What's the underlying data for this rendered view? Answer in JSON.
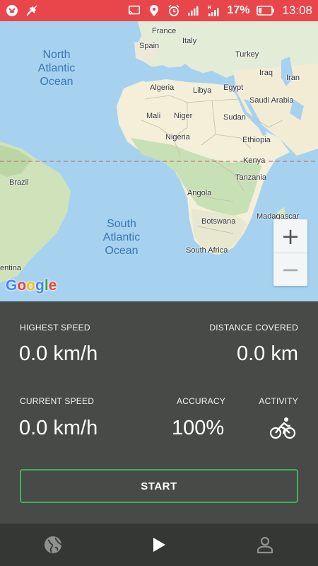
{
  "status_bar": {
    "battery_percent": "17%",
    "time": "13:08",
    "background_color": "#e8464a",
    "icons": [
      "app-notification-icon",
      "satellite-off-icon",
      "cast-icon",
      "location-pin-icon",
      "alarm-icon",
      "signal-icon",
      "roaming-signal-icon",
      "battery-icon"
    ]
  },
  "map": {
    "ocean_labels": {
      "north_atlantic": "North\nAtlantic\nOcean",
      "south_atlantic": "South\nAtlantic\nOcean"
    },
    "country_labels": {
      "france": "France",
      "italy": "Italy",
      "spain": "Spain",
      "turkey": "Turkey",
      "iraq": "Iraq",
      "iran": "Iran",
      "algeria": "Algeria",
      "libya": "Libya",
      "egypt": "Egypt",
      "saudi_arabia": "Saudi Arabia",
      "mali": "Mali",
      "niger": "Niger",
      "sudan": "Sudan",
      "ethiopia": "Ethiopia",
      "nigeria": "Nigeria",
      "kenya": "Kenya",
      "tanzania": "Tanzania",
      "brazil": "Brazil",
      "angola": "Angola",
      "madagascar": "Madagascar",
      "botswana": "Botswana",
      "south_africa": "South Africa",
      "argentina": "entina"
    },
    "zoom_in_label": "+",
    "zoom_out_label": "−",
    "google_logo": [
      "G",
      "o",
      "o",
      "g",
      "l",
      "e"
    ],
    "google_colors": [
      "#4285f4",
      "#ea4335",
      "#fbbc05",
      "#4285f4",
      "#34a853",
      "#ea4335"
    ]
  },
  "stats": {
    "highest_speed": {
      "label": "HIGHEST SPEED",
      "value": "0.0 km/h"
    },
    "distance_covered": {
      "label": "DISTANCE COVERED",
      "value": "0.0 km"
    },
    "current_speed": {
      "label": "CURRENT SPEED",
      "value": "0.0 km/h"
    },
    "accuracy": {
      "label": "ACCURACY",
      "value": "100%"
    },
    "activity": {
      "label": "ACTIVITY",
      "icon": "bicycle-icon"
    }
  },
  "start_button": {
    "label": "START",
    "border_color": "#3ab45b"
  },
  "bottom_nav": {
    "items": [
      {
        "icon": "globe-icon"
      },
      {
        "icon": "play-icon"
      },
      {
        "icon": "profile-icon"
      }
    ]
  }
}
